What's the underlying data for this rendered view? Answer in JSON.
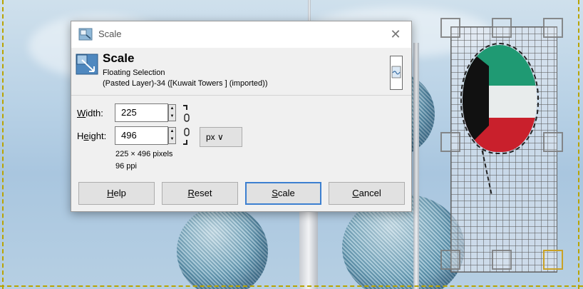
{
  "dialog": {
    "window_title": "Scale",
    "close_glyph": "✕",
    "header_title": "Scale",
    "header_subtitle": "Floating Selection",
    "header_detail": "(Pasted Layer)-34 ([Kuwait Towers ] (imported))",
    "width_label": "Width:",
    "width_value": "225",
    "height_label": "Height:",
    "height_value": "496",
    "unit": "px",
    "unit_arrow": "∨",
    "pixels_info": "225 × 496 pixels",
    "ppi_info": "96 ppi",
    "buttons": {
      "help": "Help",
      "reset": "Reset",
      "scale": "Scale",
      "cancel": "Cancel"
    },
    "icons": {
      "title": "gimp-scale-icon",
      "header": "scale-tool-icon",
      "chain": "chain-link-icon",
      "preview": "preview-icon"
    }
  },
  "colors": {
    "default_button_border": "#3c7fd0",
    "handle_active": "#c9a227",
    "guide": "#b9a400"
  }
}
